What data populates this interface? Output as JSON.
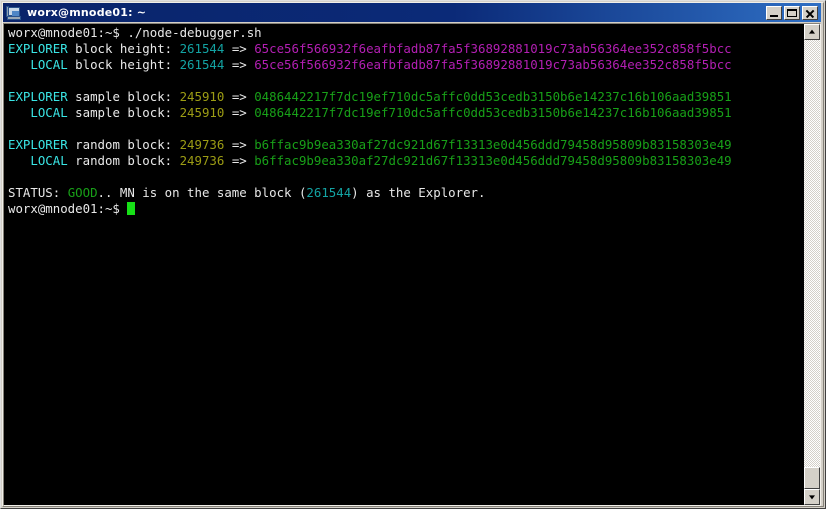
{
  "window": {
    "title": "worx@mnode01: ~",
    "icon": "computer-monitor-icon",
    "minimize_label": "Minimize",
    "maximize_label": "Maximize",
    "close_label": "Close"
  },
  "scrollbar": {
    "up_label": "Scroll up",
    "down_label": "Scroll down"
  },
  "terminal": {
    "lines": [
      {
        "id": "command-line",
        "segments": [
          {
            "text": "worx@mnode01:~$ ./node-debugger.sh",
            "color": "white"
          }
        ]
      },
      {
        "id": "explorer-block-height",
        "segments": [
          {
            "text": "EXPLORER",
            "color": "cyan"
          },
          {
            "text": " block height: ",
            "color": "white"
          },
          {
            "text": "261544",
            "color": "teal"
          },
          {
            "text": " => ",
            "color": "white"
          },
          {
            "text": "65ce56f566932f6eafbfadb87fa5f36892881019c73ab56364ee352c858f5bcc",
            "color": "magenta"
          }
        ]
      },
      {
        "id": "local-block-height",
        "segments": [
          {
            "text": "   LOCAL",
            "color": "cyan"
          },
          {
            "text": " block height: ",
            "color": "white"
          },
          {
            "text": "261544",
            "color": "teal"
          },
          {
            "text": " => ",
            "color": "white"
          },
          {
            "text": "65ce56f566932f6eafbfadb87fa5f36892881019c73ab56364ee352c858f5bcc",
            "color": "magenta"
          }
        ]
      },
      {
        "id": "blank-1",
        "segments": [
          {
            "text": " ",
            "color": "white"
          }
        ]
      },
      {
        "id": "explorer-sample-block",
        "segments": [
          {
            "text": "EXPLORER",
            "color": "cyan"
          },
          {
            "text": " sample block: ",
            "color": "white"
          },
          {
            "text": "245910",
            "color": "olive"
          },
          {
            "text": " => ",
            "color": "white"
          },
          {
            "text": "0486442217f7dc19ef710dc5affc0dd53cedb3150b6e14237c16b106aad39851",
            "color": "green"
          }
        ]
      },
      {
        "id": "local-sample-block",
        "segments": [
          {
            "text": "   LOCAL",
            "color": "cyan"
          },
          {
            "text": " sample block: ",
            "color": "white"
          },
          {
            "text": "245910",
            "color": "olive"
          },
          {
            "text": " => ",
            "color": "white"
          },
          {
            "text": "0486442217f7dc19ef710dc5affc0dd53cedb3150b6e14237c16b106aad39851",
            "color": "green"
          }
        ]
      },
      {
        "id": "blank-2",
        "segments": [
          {
            "text": " ",
            "color": "white"
          }
        ]
      },
      {
        "id": "explorer-random-block",
        "segments": [
          {
            "text": "EXPLORER",
            "color": "cyan"
          },
          {
            "text": " random block: ",
            "color": "white"
          },
          {
            "text": "249736",
            "color": "olive"
          },
          {
            "text": " => ",
            "color": "white"
          },
          {
            "text": "b6ffac9b9ea330af27dc921d67f13313e0d456ddd79458d95809b83158303e49",
            "color": "green"
          }
        ]
      },
      {
        "id": "local-random-block",
        "segments": [
          {
            "text": "   LOCAL",
            "color": "cyan"
          },
          {
            "text": " random block: ",
            "color": "white"
          },
          {
            "text": "249736",
            "color": "olive"
          },
          {
            "text": " => ",
            "color": "white"
          },
          {
            "text": "b6ffac9b9ea330af27dc921d67f13313e0d456ddd79458d95809b83158303e49",
            "color": "green"
          }
        ]
      },
      {
        "id": "blank-3",
        "segments": [
          {
            "text": " ",
            "color": "white"
          }
        ]
      },
      {
        "id": "status-line",
        "segments": [
          {
            "text": "STATUS: ",
            "color": "white"
          },
          {
            "text": "GOOD",
            "color": "green"
          },
          {
            "text": ".. MN is on the same block (",
            "color": "white"
          },
          {
            "text": "261544",
            "color": "teal"
          },
          {
            "text": ") as the Explorer.",
            "color": "white"
          }
        ]
      },
      {
        "id": "prompt-line",
        "segments": [
          {
            "text": "worx@mnode01:~$ ",
            "color": "white"
          }
        ],
        "cursor": true
      }
    ]
  },
  "colors": {
    "background": "#000000",
    "foreground": "#e8e8e8",
    "cyan": "#3ae5e5",
    "teal": "#13a3a3",
    "magenta": "#b31fb3",
    "green": "#18a018",
    "olive": "#9c9c14",
    "cursor": "#17e017",
    "titlebar_start": "#0a246a",
    "titlebar_end": "#2f6fc4",
    "chrome": "#d4d0c8"
  }
}
